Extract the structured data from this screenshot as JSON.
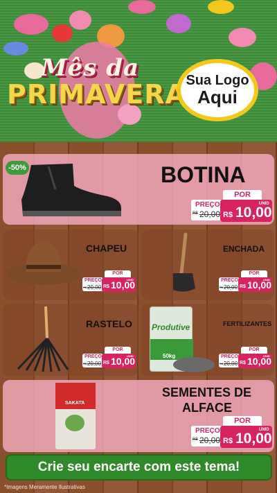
{
  "header": {
    "title_line1": "Mês da",
    "title_line2": "PRIMAVERA",
    "logo_line1": "Sua Logo",
    "logo_line2": "Aqui"
  },
  "products": [
    {
      "name": "BOTINA",
      "badge": "-50%",
      "por": "POR",
      "preco": "PREÇO",
      "old_prefix": "R$",
      "old_price": "20,00",
      "currency": "R$",
      "price": "10,00",
      "unit": "UNID"
    },
    {
      "name": "CHAPEU",
      "por": "POR",
      "preco": "PREÇO",
      "old_prefix": "R$",
      "old_price": "20,00",
      "currency": "R$",
      "price": "10,00",
      "unit": "UNID"
    },
    {
      "name": "ENCHADA",
      "por": "POR",
      "preco": "PREÇO",
      "old_prefix": "R$",
      "old_price": "20,00",
      "currency": "R$",
      "price": "10,00",
      "unit": "UNID"
    },
    {
      "name": "RASTELO",
      "por": "POR",
      "preco": "PREÇO",
      "old_prefix": "R$",
      "old_price": "20,00",
      "currency": "R$",
      "price": "10,00",
      "unit": "UNID"
    },
    {
      "name": "FERTILIZANTES",
      "por": "POR",
      "preco": "PREÇO",
      "old_prefix": "R$",
      "old_price": "20,00",
      "currency": "R$",
      "price": "10,00",
      "unit": "UNID"
    },
    {
      "name_line1": "SEMENTES DE",
      "name_line2": "ALFACE",
      "por": "POR",
      "preco": "PREÇO",
      "old_prefix": "R$",
      "old_price": "20,00",
      "currency": "R$",
      "price": "10,00",
      "unit": "UNID"
    }
  ],
  "packaging": {
    "fert_brand": "Produtive",
    "fert_weight": "50kg",
    "seed_brand": "SAKATA"
  },
  "footer": {
    "cta": "Crie seu encarte com este tema!",
    "disclaimer": "*Imagens Meramente Ilustrativas"
  },
  "colors": {
    "accent": "#d8245e",
    "green": "#2f8a2a",
    "gold": "#f3c81c"
  }
}
